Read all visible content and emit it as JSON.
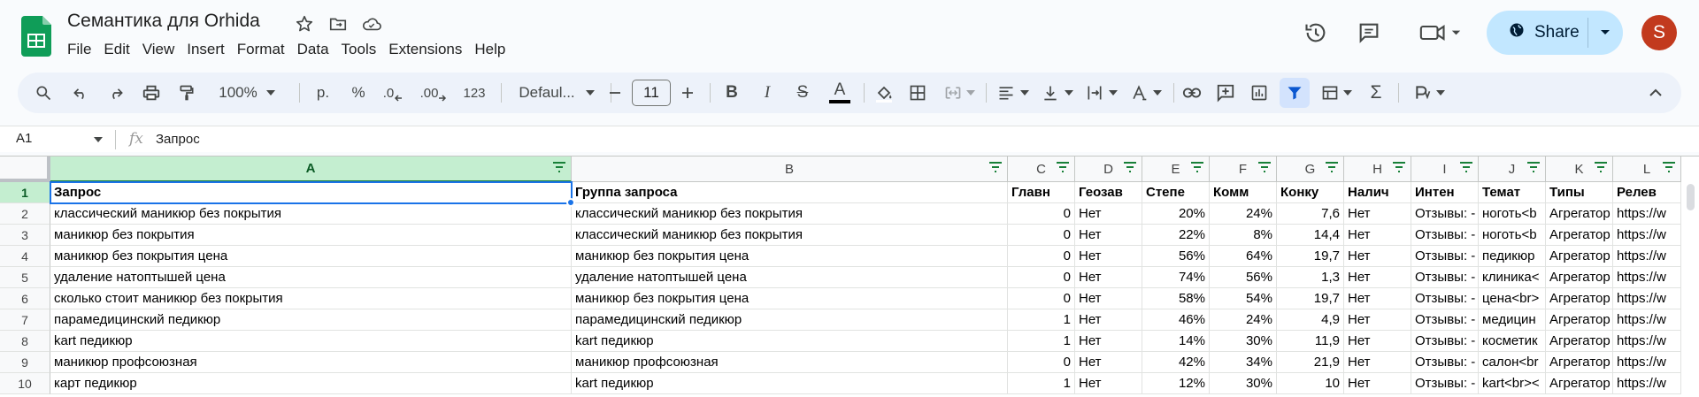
{
  "doc": {
    "title": "Семантика для Orhida"
  },
  "menu": [
    "File",
    "Edit",
    "View",
    "Insert",
    "Format",
    "Data",
    "Tools",
    "Extensions",
    "Help"
  ],
  "share": {
    "label": "Share"
  },
  "user": {
    "initial": "S",
    "color": "#c23a1e"
  },
  "toolbar": {
    "zoom": "100%",
    "currency": "р.",
    "percent": "%",
    "decrease_decimal": ".0",
    "increase_decimal": ".00",
    "number_format": "123",
    "font": "Defaul...",
    "font_size": "11"
  },
  "formula": {
    "cell_ref": "A1",
    "fx": "fx",
    "content": "Запрос"
  },
  "columns": [
    "A",
    "B",
    "C",
    "D",
    "E",
    "F",
    "G",
    "H",
    "I",
    "J",
    "K",
    "L"
  ],
  "rows": [
    "1",
    "2",
    "3",
    "4",
    "5",
    "6",
    "7",
    "8",
    "9",
    "10"
  ],
  "headers": [
    "Запрос",
    "Группа запроса",
    "Главн",
    "Геозав",
    "Степе",
    "Комм",
    "Конку",
    "Налич",
    "Интен",
    "Темат",
    "Типы",
    "Релев"
  ],
  "data": [
    [
      "классический маникюр без покрытия",
      "классический маникюр без покрытия",
      "0",
      "Нет",
      "20%",
      "24%",
      "7,6",
      "Нет",
      "Отзывы: -",
      "ноготь<b",
      "Агрегатор",
      "https://w"
    ],
    [
      "маникюр без покрытия",
      "классический маникюр без покрытия",
      "0",
      "Нет",
      "22%",
      "8%",
      "14,4",
      "Нет",
      "Отзывы: -",
      "ноготь<b",
      "Агрегатор",
      "https://w"
    ],
    [
      "маникюр без покрытия цена",
      "маникюр без покрытия цена",
      "0",
      "Нет",
      "56%",
      "64%",
      "19,7",
      "Нет",
      "Отзывы: -",
      "педикюр",
      "Агрегатор",
      "https://w"
    ],
    [
      "удаление натоптышей цена",
      "удаление натоптышей цена",
      "0",
      "Нет",
      "74%",
      "56%",
      "1,3",
      "Нет",
      "Отзывы: -",
      "клиника<",
      "Агрегатор",
      "https://w"
    ],
    [
      "сколько стоит маникюр без покрытия",
      "маникюр без покрытия цена",
      "0",
      "Нет",
      "58%",
      "54%",
      "19,7",
      "Нет",
      "Отзывы: -",
      "цена<br>",
      "Агрегатор",
      "https://w"
    ],
    [
      "парамедицинский педикюр",
      "парамедицинский педикюр",
      "1",
      "Нет",
      "46%",
      "24%",
      "4,9",
      "Нет",
      "Отзывы: -",
      "медицин",
      "Агрегатор",
      "https://w"
    ],
    [
      "kart педикюр",
      "kart педикюр",
      "1",
      "Нет",
      "14%",
      "30%",
      "11,9",
      "Нет",
      "Отзывы: -",
      "косметик",
      "Агрегатор",
      "https://w"
    ],
    [
      "маникюр профсоюзная",
      "маникюр профсоюзная",
      "0",
      "Нет",
      "42%",
      "34%",
      "21,9",
      "Нет",
      "Отзывы: -",
      "салон<br",
      "Агрегатор",
      "https://w"
    ],
    [
      "карт педикюр",
      "kart педикюр",
      "1",
      "Нет",
      "12%",
      "30%",
      "10",
      "Нет",
      "Отзывы: -",
      "kart<br><",
      "Агрегатор",
      "https://w"
    ]
  ]
}
